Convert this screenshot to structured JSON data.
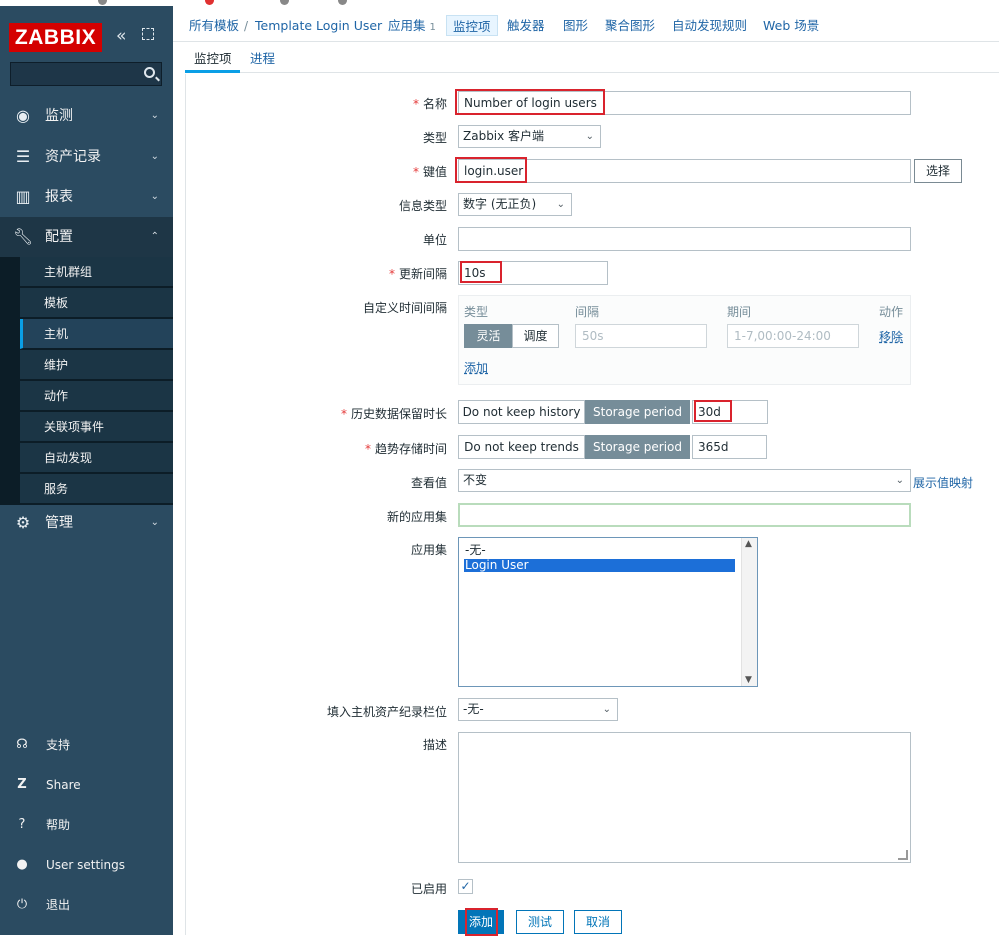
{
  "sidebar": {
    "logo": "ZABBIX",
    "collapse_icon": "double-chevron-left",
    "kiosk_icon": "fullscreen",
    "search_placeholder": "",
    "menu": [
      {
        "label": "监测",
        "icon": "eye"
      },
      {
        "label": "资产记录",
        "icon": "list"
      },
      {
        "label": "报表",
        "icon": "bar-chart"
      },
      {
        "label": "配置",
        "icon": "wrench"
      },
      {
        "label": "管理",
        "icon": "gear"
      }
    ],
    "config_sub": [
      "主机群组",
      "模板",
      "主机",
      "维护",
      "动作",
      "关联项事件",
      "自动发现",
      "服务"
    ],
    "bottom": [
      {
        "label": "支持",
        "icon": "headset"
      },
      {
        "label": "Share",
        "icon": "share"
      },
      {
        "label": "帮助",
        "icon": "question"
      },
      {
        "label": "User settings",
        "icon": "user"
      },
      {
        "label": "退出",
        "icon": "power"
      }
    ]
  },
  "topnav": {
    "breadcrumb_root": "所有模板",
    "template": "Template Login User",
    "applications": "应用集",
    "applications_count": "1",
    "items": "监控项",
    "triggers": "触发器",
    "graphs": "图形",
    "screens": "聚合图形",
    "discovery": "自动发现规则",
    "web": "Web 场景"
  },
  "tabs": [
    "监控项",
    "进程"
  ],
  "form": {
    "name_label": "名称",
    "name_value": "Number of login users",
    "type_label": "类型",
    "type_value": "Zabbix 客户端",
    "key_label": "键值",
    "key_value": "login.user",
    "key_select": "选择",
    "info_type_label": "信息类型",
    "info_type_value": "数字 (无正负)",
    "units_label": "单位",
    "units_value": "",
    "interval_label": "更新间隔",
    "interval_value": "10s",
    "custom_label": "自定义时间间隔",
    "custom_head_type": "类型",
    "custom_head_interval": "间隔",
    "custom_head_period": "期间",
    "custom_head_action": "动作",
    "custom_flexible": "灵活",
    "custom_scheduling": "调度",
    "custom_interval_ph": "50s",
    "custom_period_ph": "1-7,00:00-24:00",
    "custom_remove": "移除",
    "custom_add": "添加",
    "history_label": "历史数据保留时长",
    "history_nokeep": "Do not keep history",
    "history_period": "Storage period",
    "history_value": "30d",
    "trends_label": "趋势存储时间",
    "trends_nokeep": "Do not keep trends",
    "trends_period": "Storage period",
    "trends_value": "365d",
    "valuemap_label": "查看值",
    "valuemap_value": "不变",
    "valuemap_link": "展示值映射",
    "new_app_label": "新的应用集",
    "new_app_value": "",
    "apps_label": "应用集",
    "apps_options": [
      "-无-",
      "Login User"
    ],
    "inventory_label": "填入主机资产纪录栏位",
    "inventory_value": "-无-",
    "desc_label": "描述",
    "desc_value": "",
    "enabled_label": "已启用",
    "enabled": true
  },
  "buttons": {
    "add": "添加",
    "test": "测试",
    "cancel": "取消"
  },
  "colors": {
    "sidebar": "#2b4b61",
    "accent": "#0275b8",
    "logo": "#d40000",
    "highlight": "#d9232d"
  }
}
